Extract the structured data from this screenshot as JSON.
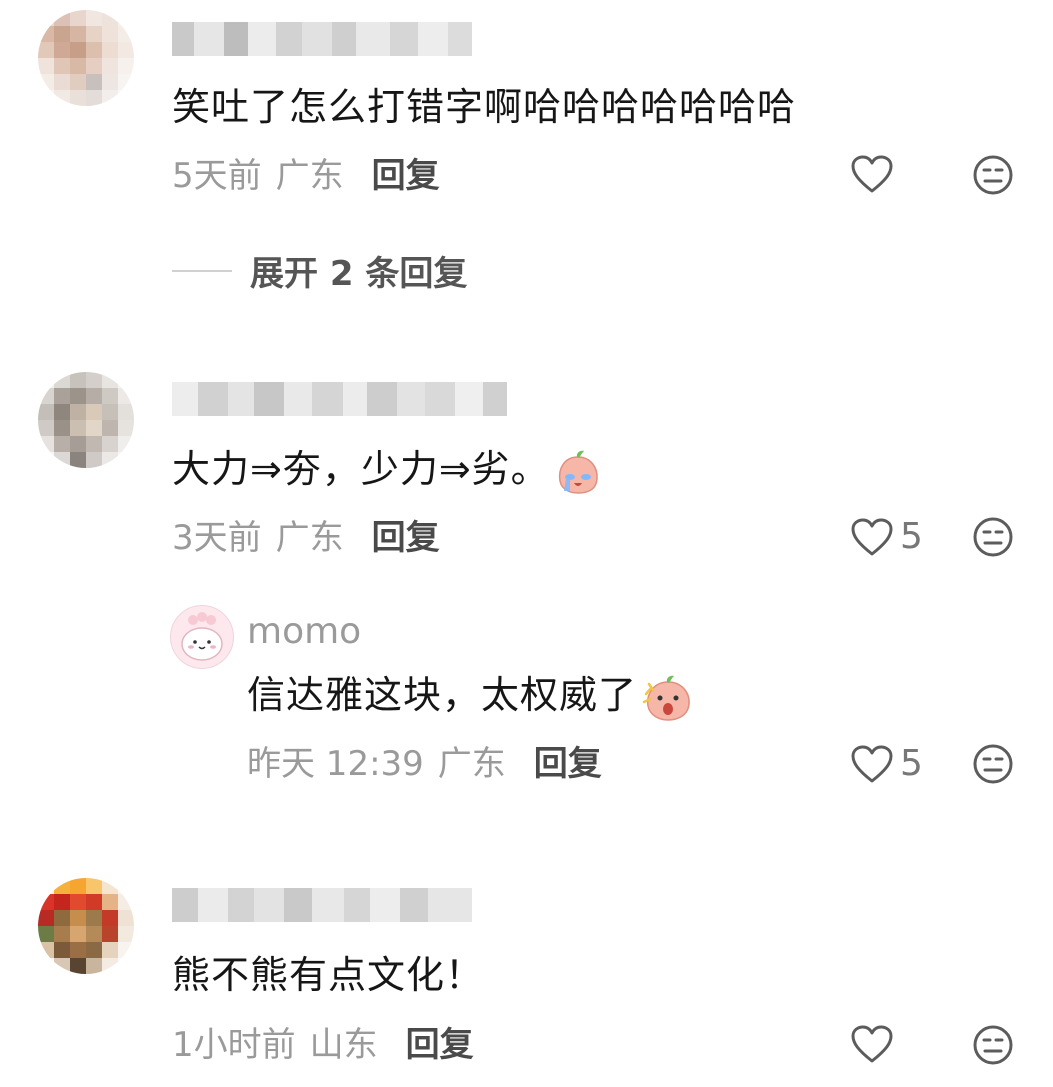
{
  "comments": [
    {
      "text": "笑吐了怎么打错字啊哈哈哈哈哈哈哈",
      "time": "5天前",
      "location": "广东",
      "reply_label": "回复",
      "likes": "",
      "expand_label": "展开 2 条回复"
    },
    {
      "text": "大力⇒夯，少力⇒劣。",
      "time": "3天前",
      "location": "广东",
      "reply_label": "回复",
      "likes": "5",
      "sub_reply": {
        "username": "momo",
        "text": "信达雅这块，太权威了",
        "time": "昨天 12:39",
        "location": "广东",
        "reply_label": "回复",
        "likes": "5"
      }
    },
    {
      "text": "熊不熊有点文化！",
      "time": "1小时前",
      "location": "山东",
      "reply_label": "回复",
      "likes": ""
    }
  ],
  "icons": {
    "like": "heart-outline-icon",
    "dislike": "neutral-face-icon",
    "emoji_crying": "crying-peach-emoji",
    "emoji_shocked": "shocked-peach-emoji"
  },
  "colors": {
    "meta_gray": "#9a9a9a",
    "reply_dark": "#4a4a4a",
    "text": "#161616"
  }
}
